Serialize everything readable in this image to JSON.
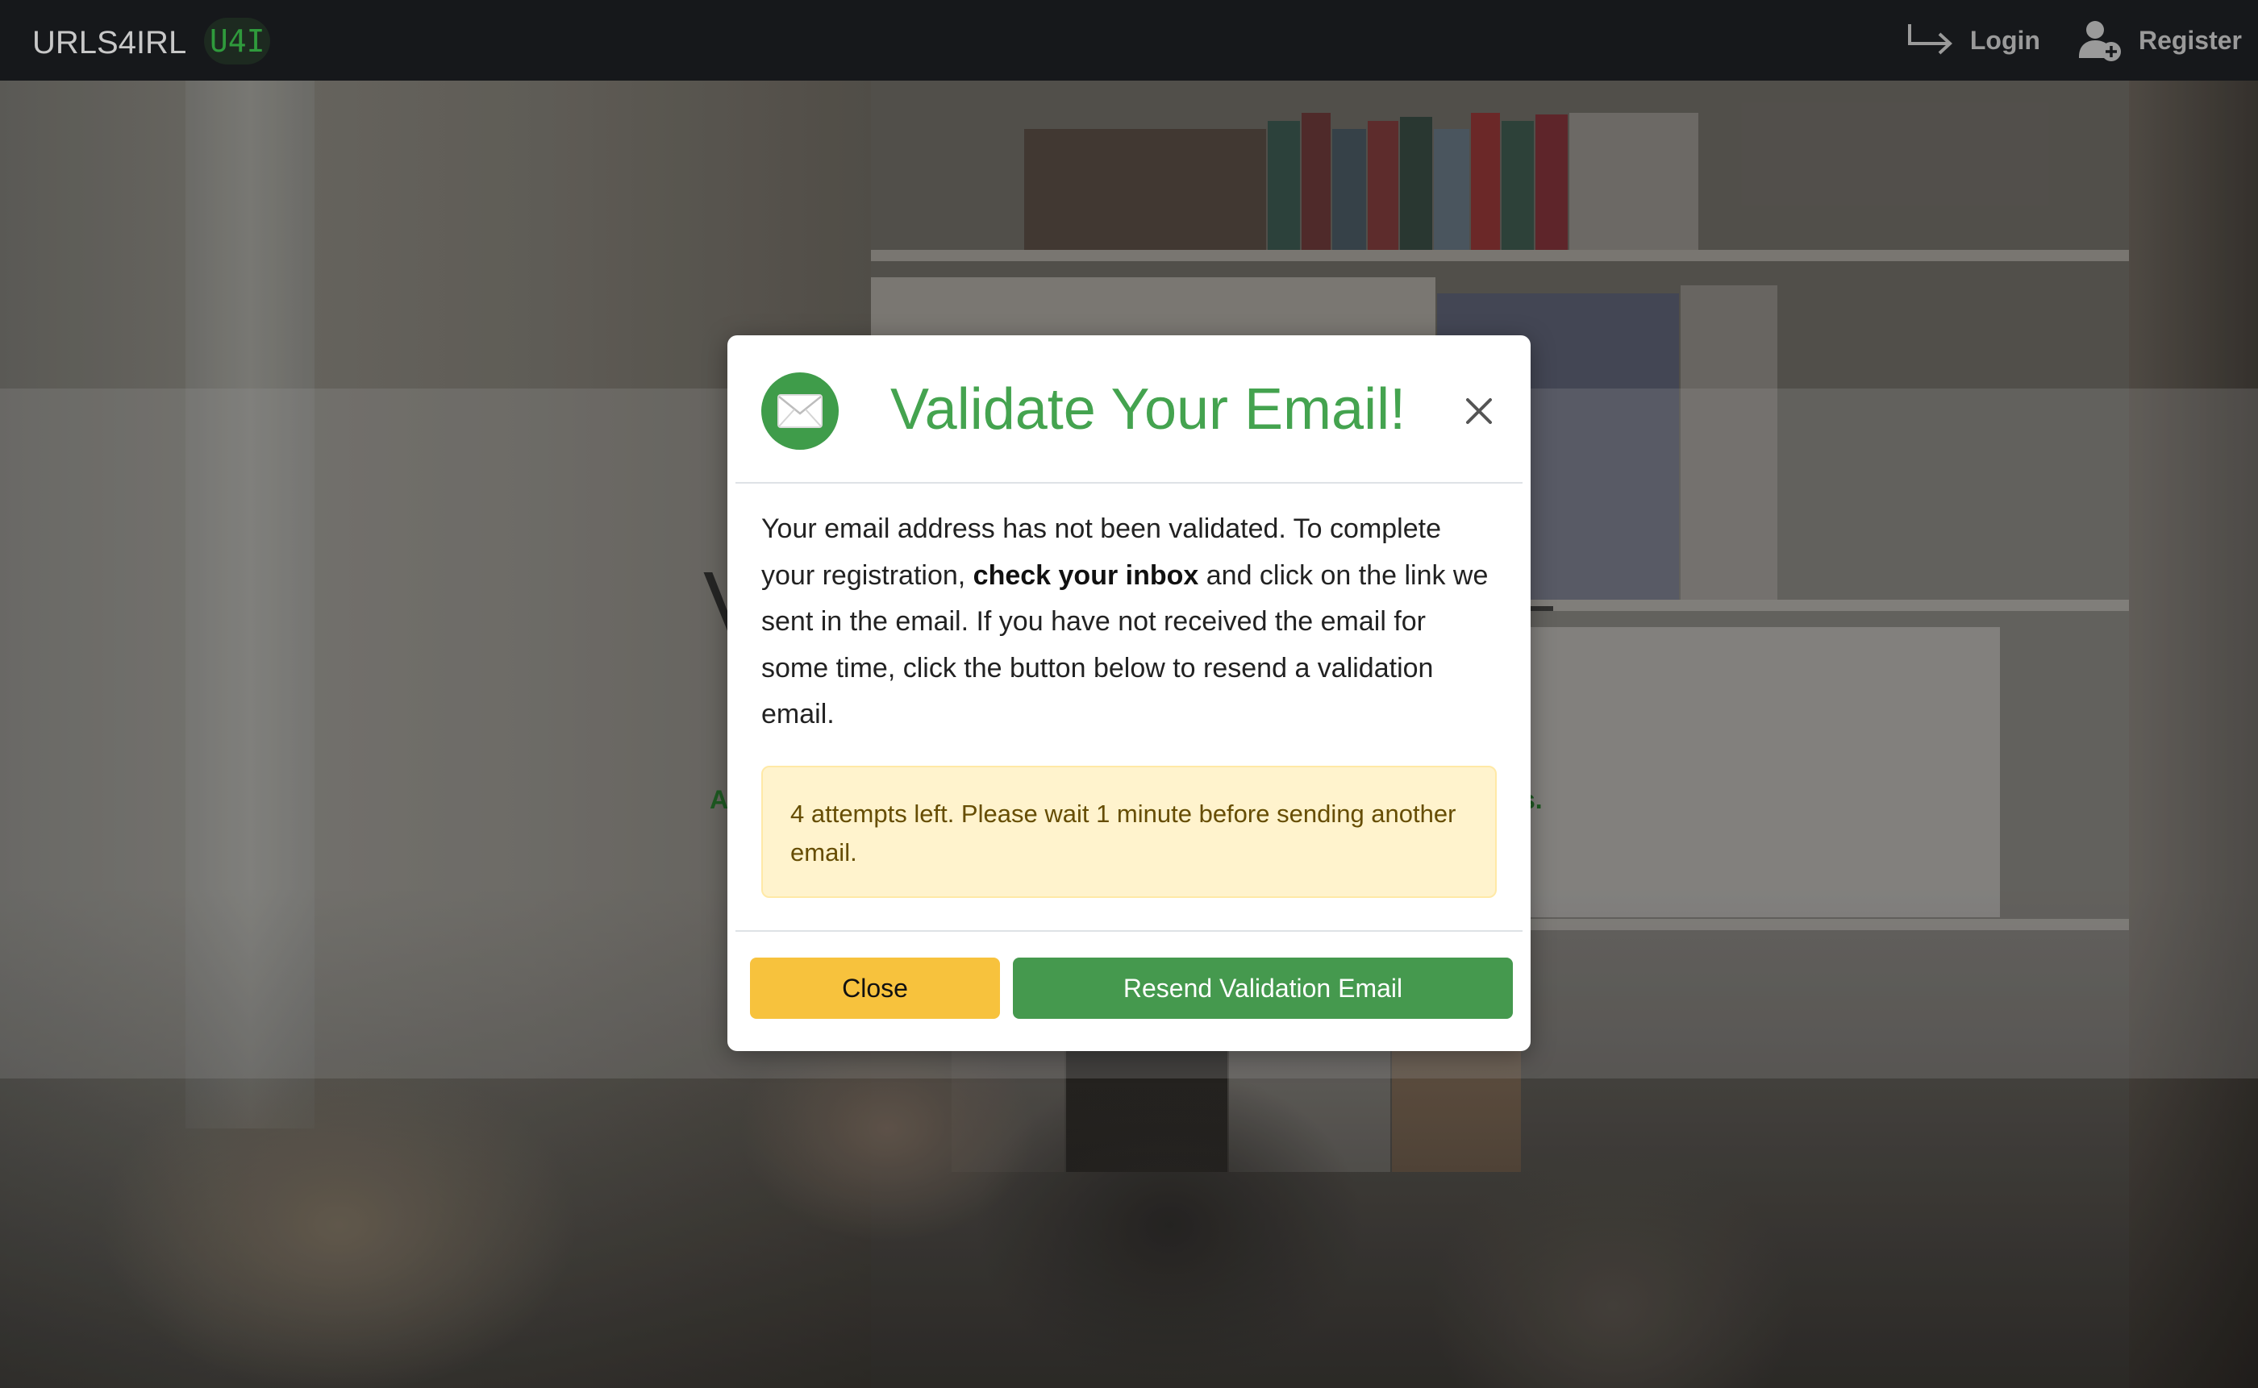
{
  "navbar": {
    "brand": "URLS4IRL",
    "brand_mark": "U4I",
    "login_label": "Login",
    "register_label": "Register",
    "login_icon": "login-arrow-icon",
    "register_icon": "user-plus-icon"
  },
  "hero": {
    "peek_title_left": "V",
    "peek_subtitle_left": "A",
    "peek_subtitle_right": "s."
  },
  "modal": {
    "icon": "envelope-icon",
    "title": "Validate Your Email!",
    "close_icon": "close-icon",
    "body": {
      "part1": "Your email address has not been validated. To complete your registration, ",
      "bold": "check your inbox",
      "part2": " and click on the link we sent in the email. If you have not received the email for some time, click the button below to resend a validation email."
    },
    "alert": "4 attempts left. Please wait 1 minute before sending another email.",
    "buttons": {
      "close": "Close",
      "resend": "Resend Validation Email"
    }
  },
  "colors": {
    "navbar_bg": "#16181b",
    "accent_green": "#44a34f",
    "button_green": "#45994e",
    "button_yellow": "#f7c23d",
    "alert_bg": "#fff3cd",
    "alert_text": "#664d03"
  }
}
